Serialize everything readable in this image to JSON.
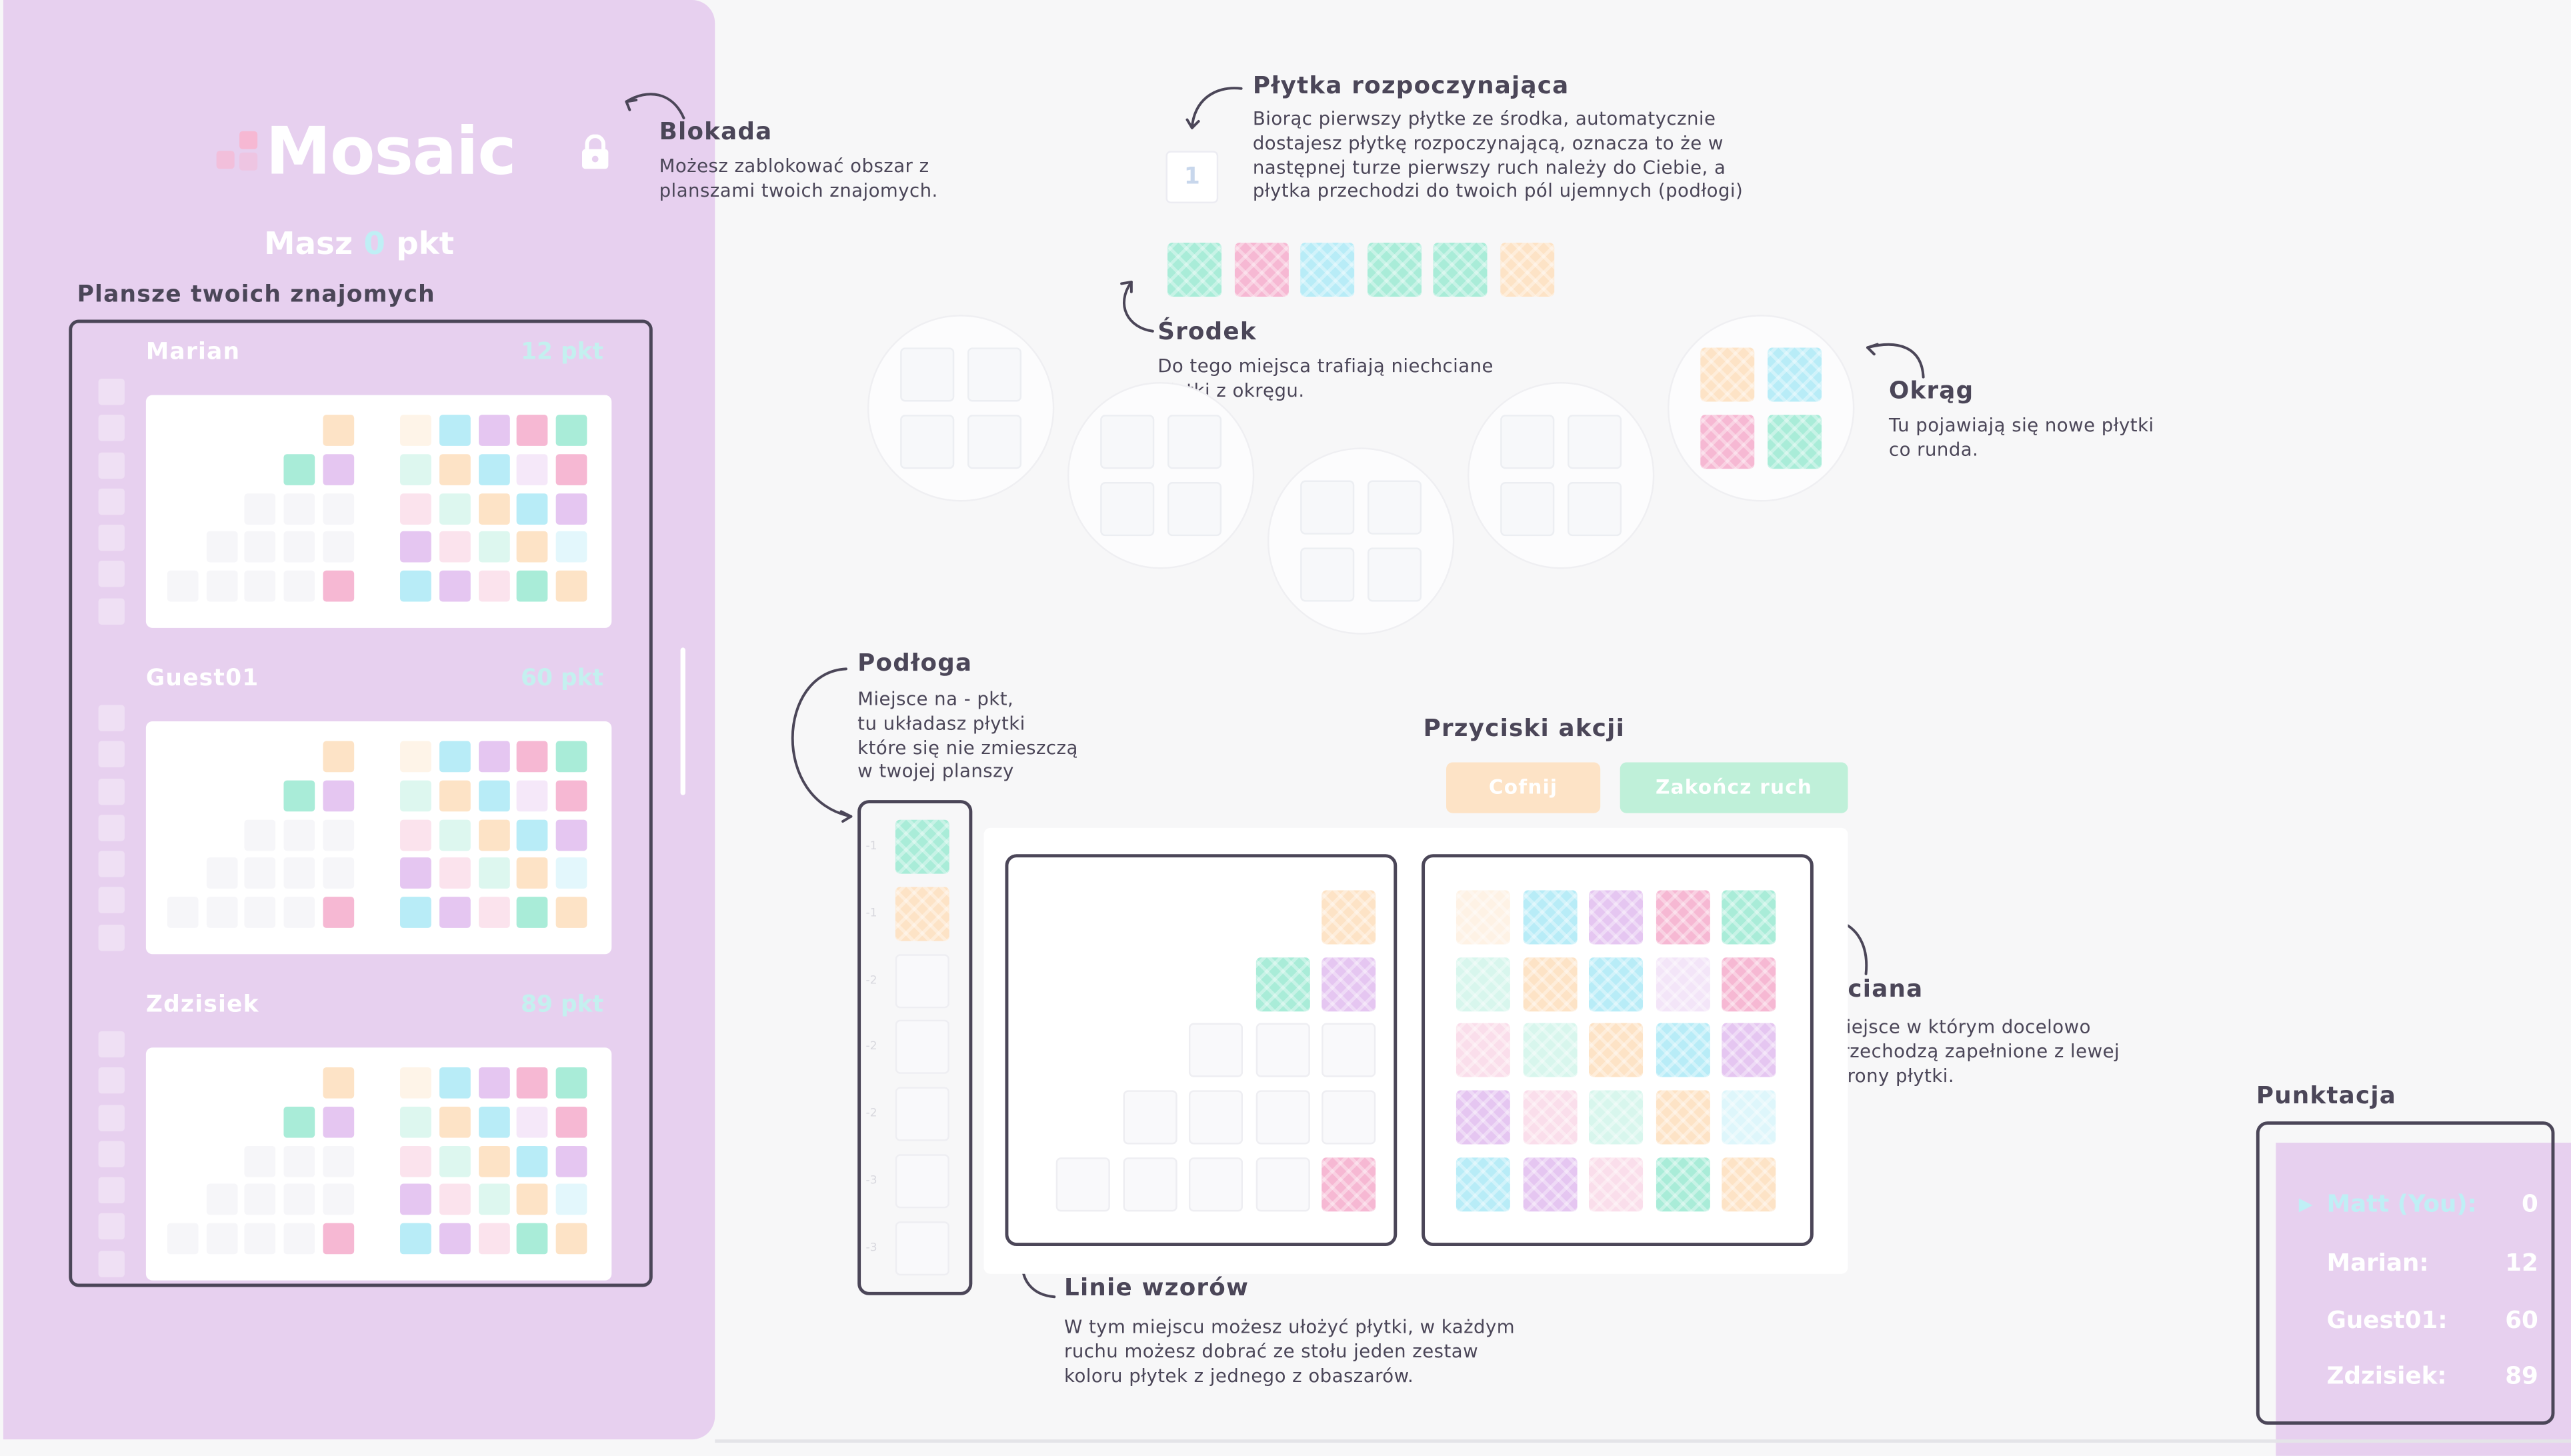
{
  "app": {
    "logo": "Mosaic",
    "you_score_prefix": "Masz",
    "you_score": "0",
    "you_score_suffix": "pkt"
  },
  "friends": {
    "title": "Plansze twoich znajomych",
    "boards": [
      {
        "name": "Marian",
        "points": "12 pkt"
      },
      {
        "name": "Guest01",
        "points": "60 pkt"
      },
      {
        "name": "Zdzisiek",
        "points": "89 pkt"
      }
    ]
  },
  "annotations": {
    "blokada": {
      "title": "Blokada",
      "text": [
        "Możesz zablokować obszar z",
        "planszami twoich znajomych."
      ]
    },
    "starting_tile": {
      "title": "Płytka rozpoczynająca",
      "text": [
        "Biorąc pierwszy płytke ze środka, automatycznie",
        "dostajesz płytkę rozpoczynającą, oznacza to że w",
        "następnej turze pierwszy ruch należy do Ciebie, a",
        "płytka przechodzi do twoich pól ujemnych (podłogi)"
      ]
    },
    "center": {
      "title": "Środek",
      "text": [
        "Do tego miejsca trafiają niechciane",
        "płytki z okręgu."
      ]
    },
    "circle": {
      "title": "Okrąg",
      "text": [
        "Tu pojawiają się nowe płytki",
        "co runda."
      ]
    },
    "floor": {
      "title": "Podłoga",
      "text": [
        "Miejsce na - pkt,",
        "tu układasz płytki",
        "które się nie zmieszczą",
        "w twojej planszy"
      ]
    },
    "actions": {
      "title": "Przyciski akcji"
    },
    "wall": {
      "title": "Ściana",
      "text": [
        "Miejsce w którym docelowo",
        "przechodzą zapełnione z lewej",
        "strony płytki."
      ]
    },
    "pattern_lines": {
      "title": "Linie wzorów",
      "text": [
        "W tym miejscu możesz ułożyć płytki, w każdym",
        "ruchu możesz dobrać ze stołu jeden zestaw",
        "koloru płytek z jednego z obaszarów."
      ]
    }
  },
  "starting_tile_number": "1",
  "center_tiles": [
    "green",
    "pink",
    "blue",
    "green",
    "green",
    "orange"
  ],
  "circle_tiles": [
    "orange",
    "blue",
    "pink",
    "green"
  ],
  "buttons": {
    "undo": "Cofnij",
    "end_turn": "Zakończ ruch"
  },
  "floor_values": [
    "-1",
    "-1",
    "-2",
    "-2",
    "-2",
    "-3",
    "-3"
  ],
  "floor_tiles": [
    "green",
    "orange"
  ],
  "wall_pattern": [
    [
      "orange",
      "blue",
      "purple",
      "pink",
      "green"
    ],
    [
      "green",
      "orange",
      "blue",
      "purple",
      "pink"
    ],
    [
      "pink",
      "green",
      "orange",
      "blue",
      "purple"
    ],
    [
      "purple",
      "pink",
      "green",
      "orange",
      "blue"
    ],
    [
      "blue",
      "purple",
      "pink",
      "green",
      "orange"
    ]
  ],
  "wall_filled": [
    [
      false,
      true,
      true,
      true,
      true
    ],
    [
      false,
      true,
      true,
      false,
      true
    ],
    [
      false,
      false,
      true,
      true,
      true
    ],
    [
      true,
      false,
      false,
      true,
      false
    ],
    [
      true,
      true,
      false,
      true,
      true
    ]
  ],
  "pattern_lines": [
    [
      "orange"
    ],
    [
      "green",
      "purple"
    ],
    [
      null,
      null,
      null
    ],
    [
      null,
      null,
      null,
      null
    ],
    [
      null,
      null,
      null,
      null,
      "pink"
    ]
  ],
  "scoreboard": {
    "title": "Punktacja",
    "rows": [
      {
        "name": "Matt (You):",
        "score": "0",
        "you": true
      },
      {
        "name": "Marian:",
        "score": "12"
      },
      {
        "name": "Guest01:",
        "score": "60"
      },
      {
        "name": "Zdzisiek:",
        "score": "89"
      }
    ]
  },
  "colors": {
    "sidebar": "#e7d0ef",
    "green": "#a9ecd8",
    "pink": "#f6b8d3",
    "blue": "#b8ecf7",
    "orange": "#fde3c6",
    "purple": "#e5c6f1",
    "text": "#4b4658",
    "undo_button": "#fde3c6",
    "end_turn_button": "#bff0d9"
  }
}
